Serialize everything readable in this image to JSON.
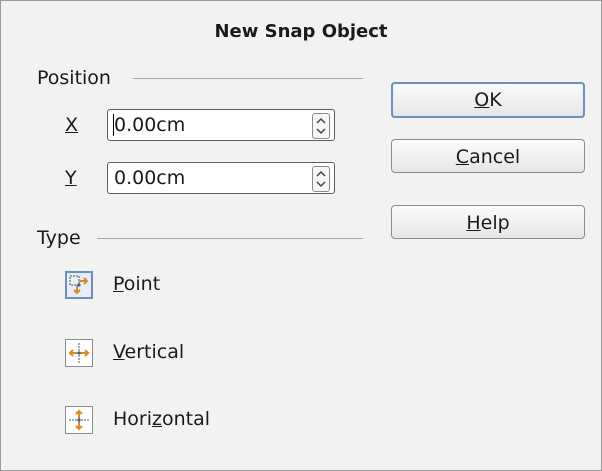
{
  "dialog": {
    "title": "New Snap Object"
  },
  "position": {
    "heading": "Position",
    "x": {
      "label": "X",
      "value": "0.00cm"
    },
    "y": {
      "label": "Y",
      "value": "0.00cm"
    }
  },
  "type": {
    "heading": "Type",
    "options": [
      {
        "first": "P",
        "rest": "oint",
        "selected": true,
        "icon": "snap-point-icon"
      },
      {
        "first": "V",
        "rest": "ertical",
        "selected": false,
        "icon": "snap-vertical-icon"
      },
      {
        "pre": "Hori",
        "u": "z",
        "post": "ontal",
        "selected": false,
        "icon": "snap-horizontal-icon"
      }
    ]
  },
  "buttons": {
    "ok": {
      "u": "O",
      "rest": "K"
    },
    "cancel": {
      "u": "C",
      "rest": "ancel"
    },
    "help": {
      "u": "H",
      "rest": "elp"
    }
  },
  "colors": {
    "accent": "#6b8fc4",
    "icon_orange": "#e08a1e",
    "icon_blue": "#2f63b5"
  }
}
